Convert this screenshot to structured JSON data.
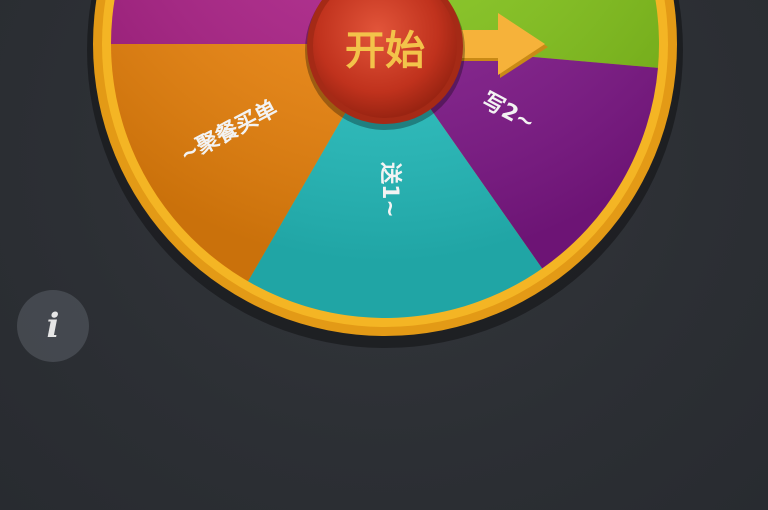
{
  "wheel": {
    "start_label": "开始",
    "segments": [
      {
        "id": "magenta",
        "color": "#b0208a",
        "label": ""
      },
      {
        "id": "green",
        "color": "#86c91a",
        "label": ""
      },
      {
        "id": "purple",
        "color": "#85198f",
        "label": "写2~"
      },
      {
        "id": "cyan",
        "color": "#27c9c9",
        "label": "送1~"
      },
      {
        "id": "orange",
        "color": "#f78a0d",
        "label": "~聚餐买单"
      }
    ],
    "rim_color": "#f0a51a",
    "pointer_color": "#f2a42a",
    "hub_color": "#c9351f"
  },
  "info_button": {
    "icon": "info-icon",
    "glyph": "i"
  }
}
